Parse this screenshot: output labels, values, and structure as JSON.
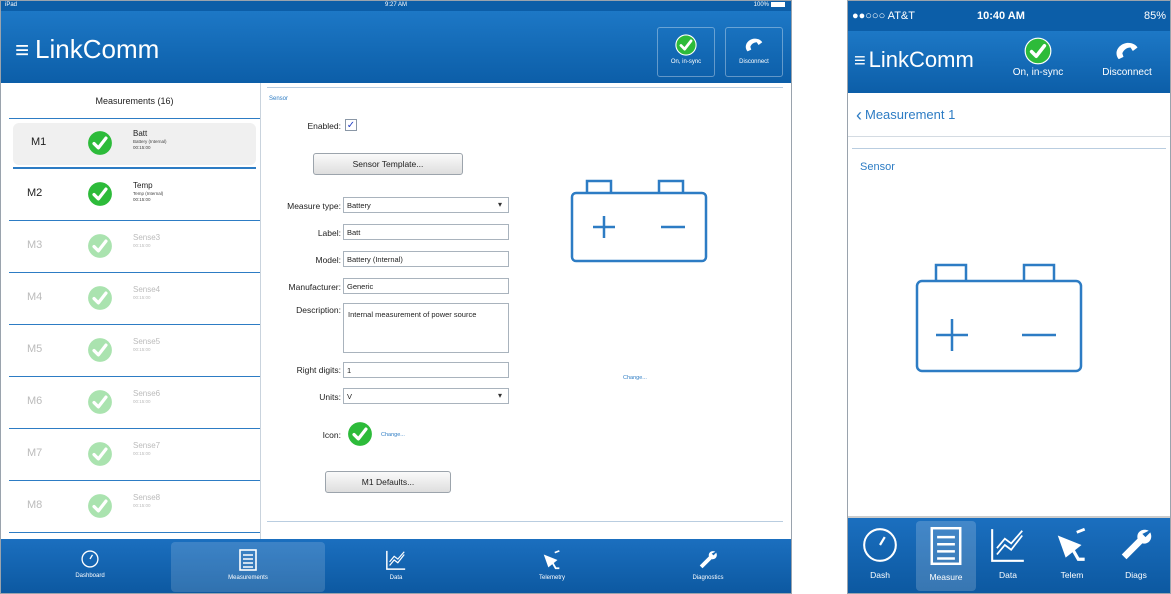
{
  "ipad": {
    "status": {
      "carrier": "iPad",
      "time": "9:27 AM",
      "battery": "100%"
    },
    "app_title": "LinkComm",
    "sync_label": "On, in-sync",
    "disconnect_label": "Disconnect",
    "list_title": "Measurements (16)",
    "measurements": [
      {
        "id": "M1",
        "name": "Batt",
        "sub1": "Battery (Internal)",
        "sub2": "00:15:00"
      },
      {
        "id": "M2",
        "name": "Temp",
        "sub1": "Temp (Internal)",
        "sub2": "00:15:00"
      },
      {
        "id": "M3",
        "name": "Sense3",
        "sub1": "00:15:00",
        "sub2": ""
      },
      {
        "id": "M4",
        "name": "Sense4",
        "sub1": "00:15:00",
        "sub2": ""
      },
      {
        "id": "M5",
        "name": "Sense5",
        "sub1": "00:15:00",
        "sub2": ""
      },
      {
        "id": "M6",
        "name": "Sense6",
        "sub1": "00:15:00",
        "sub2": ""
      },
      {
        "id": "M7",
        "name": "Sense7",
        "sub1": "00:15:00",
        "sub2": ""
      },
      {
        "id": "M8",
        "name": "Sense8",
        "sub1": "00:15:00",
        "sub2": ""
      }
    ],
    "form": {
      "section": "Sensor",
      "enabled_label": "Enabled:",
      "template_button": "Sensor Template...",
      "measure_type_label": "Measure type:",
      "measure_type_value": "Battery",
      "label_label": "Label:",
      "label_value": "Batt",
      "model_label": "Model:",
      "model_value": "Battery (Internal)",
      "manufacturer_label": "Manufacturer:",
      "manufacturer_value": "Generic",
      "description_label": "Description:",
      "description_value": "Internal measurement of power source",
      "right_digits_label": "Right digits:",
      "right_digits_value": "1",
      "units_label": "Units:",
      "units_value": "V",
      "icon_label": "Icon:",
      "icon_change": "Change...",
      "image_change": "Change...",
      "defaults_button": "M1 Defaults..."
    },
    "tabs": [
      "Dashboard",
      "Measurements",
      "Data",
      "Telemetry",
      "Diagnostics"
    ]
  },
  "iphone": {
    "status": {
      "carrier": "●●○○○ AT&T",
      "time": "10:40 AM",
      "battery": "85%"
    },
    "app_title": "LinkComm",
    "sync_label": "On, in-sync",
    "disconnect_label": "Disconnect",
    "back_label": "Measurement 1",
    "section": "Sensor",
    "tabs": [
      "Dash",
      "Measure",
      "Data",
      "Telem",
      "Diags"
    ]
  },
  "colors": {
    "brand_blue": "#0c5ea8",
    "accent_blue": "#2d7cc4",
    "check_green": "#2dbb3a"
  },
  "icons": [
    "check-icon",
    "phone-icon",
    "gauge-icon",
    "list-icon",
    "chart-icon",
    "satellite-icon",
    "wrench-icon",
    "battery-icon"
  ]
}
